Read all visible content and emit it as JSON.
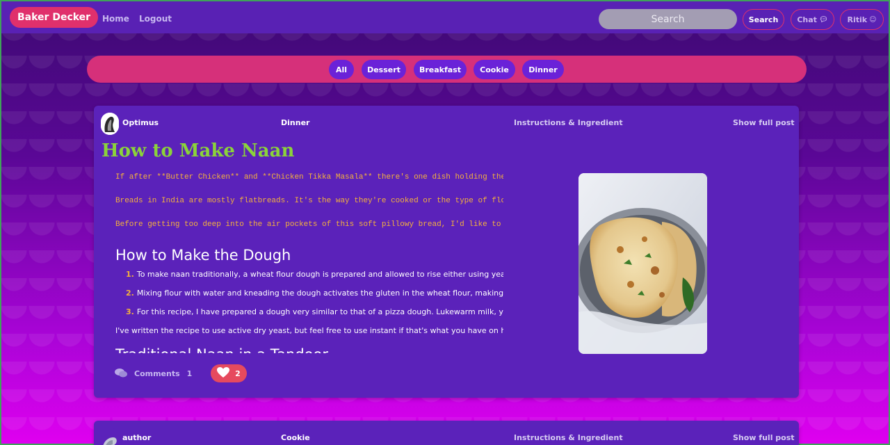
{
  "navbar": {
    "brand": "Baker Decker",
    "links": [
      "Home",
      "Logout"
    ],
    "search_placeholder": "Search",
    "search_button": "Search",
    "chat_button": "Chat",
    "user_button": "Ritik"
  },
  "categories": [
    "All",
    "Dessert",
    "Breakfast",
    "Cookie",
    "Dinner"
  ],
  "posts": [
    {
      "author": "Optimus",
      "category": "Dinner",
      "instructions_label": "Instructions & Ingredient",
      "show_full_label": "Show full post",
      "title": "How to Make Naan",
      "intro_lines": [
        "If after **Butter Chicken** and **Chicken Tikka Masala** there's one dish holding the",
        "Breads in India are mostly flatbreads. It's the way they're cooked or the type of flou",
        "Before getting too deep into the air pockets of this soft pillowy bread, I'd like to c"
      ],
      "subheading": "How to Make the Dough",
      "steps": [
        "To make naan traditionally, a wheat flour dough is prepared and allowed to rise either using yeast, or by t",
        "Mixing flour with water and kneading the dough activates the gluten in the wheat flour, making the doug",
        "For this recipe, I have prepared a dough very similar to that of a pizza dough. Lukewarm milk, yogurt, yea"
      ],
      "note": "I've written the recipe to use active dry yeast, but feel free to use instant if that's what you have on hand. If usi",
      "subheading2": "Traditional Naan in a Tandoor",
      "comments_label": "Comments",
      "comments_count": "1",
      "likes": "2"
    },
    {
      "author": "author",
      "category": "Cookie",
      "instructions_label": "Instructions & Ingredient",
      "show_full_label": "Show full post"
    }
  ],
  "colors": {
    "navbar": "#5921b4",
    "brand": "#e0306c",
    "category_bar": "#d6307a",
    "card": "#5b22ba",
    "title": "#8bd33a",
    "intro_text": "#f5b23c"
  },
  "icons": [
    "chat-icon",
    "user-icon",
    "comments-icon",
    "heart-icon"
  ]
}
